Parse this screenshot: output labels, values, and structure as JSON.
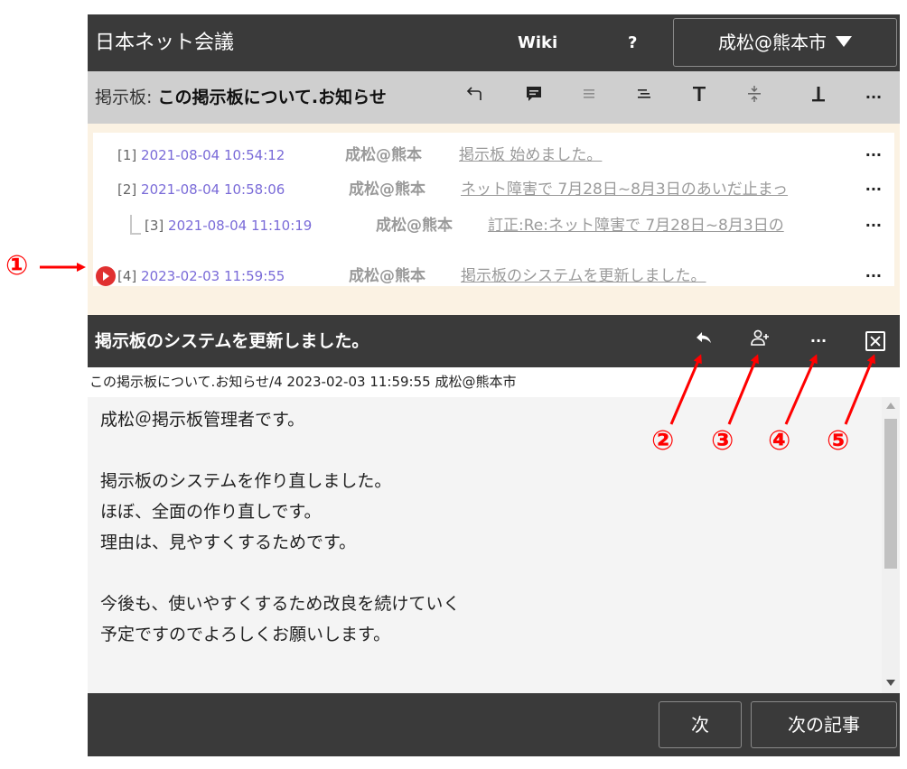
{
  "header": {
    "title": "日本ネット会議",
    "wiki": "Wiki",
    "help": "?",
    "user": "成松@熊本市"
  },
  "board": {
    "label": "掲示板:",
    "name": "この掲示板について.お知らせ",
    "tools": [
      "back-arrow-icon",
      "comment-icon",
      "align-left-icon",
      "align-right-icon",
      "align-top-icon",
      "align-middle-icon",
      "align-bottom-icon",
      "more-icon"
    ],
    "more": "···"
  },
  "threads": [
    {
      "num": "[1]",
      "datetime": "2021-08-04 10:54:12",
      "author": "成松@熊本",
      "subject": "掲示板 始めました。",
      "more": "···"
    },
    {
      "num": "[2]",
      "datetime": "2021-08-04 10:58:06",
      "author": "成松@熊本",
      "subject": "ネット障害で 7月28日~8月3日のあいだ止まっ",
      "more": "···"
    },
    {
      "num": "[3]",
      "datetime": "2021-08-04 11:10:19",
      "author": "成松@熊本",
      "subject": "訂正:Re:ネット障害で 7月28日~8月3日の",
      "more": "···"
    },
    {
      "num": "[4]",
      "datetime": "2023-02-03 11:59:55",
      "author": "成松@熊本",
      "subject": "掲示板のシステムを更新しました。",
      "more": "···"
    }
  ],
  "article": {
    "title": "掲示板のシステムを更新しました。",
    "more": "···",
    "meta": "この掲示板について.お知らせ/4 2023-02-03 11:59:55 成松@熊本市",
    "lines": [
      "成松＠掲示板管理者です。",
      "",
      "掲示板のシステムを作り直しました。",
      "ほぼ、全面の作り直しです。",
      "理由は、見やすくするためです。",
      "",
      "今後も、使いやすくするため改良を続けていく",
      "予定ですのでよろしくお願いします。"
    ]
  },
  "footer": {
    "next": "次",
    "next_article": "次の記事"
  },
  "annotations": [
    "①",
    "②",
    "③",
    "④",
    "⑤"
  ],
  "colors": {
    "dark_bar": "#3a3a3a",
    "toolbar": "#cfcfcf",
    "list_bg": "#fbf2e3",
    "date_link": "#7a6bd8",
    "current_marker": "#e03030",
    "annotation": "#ff0000"
  }
}
